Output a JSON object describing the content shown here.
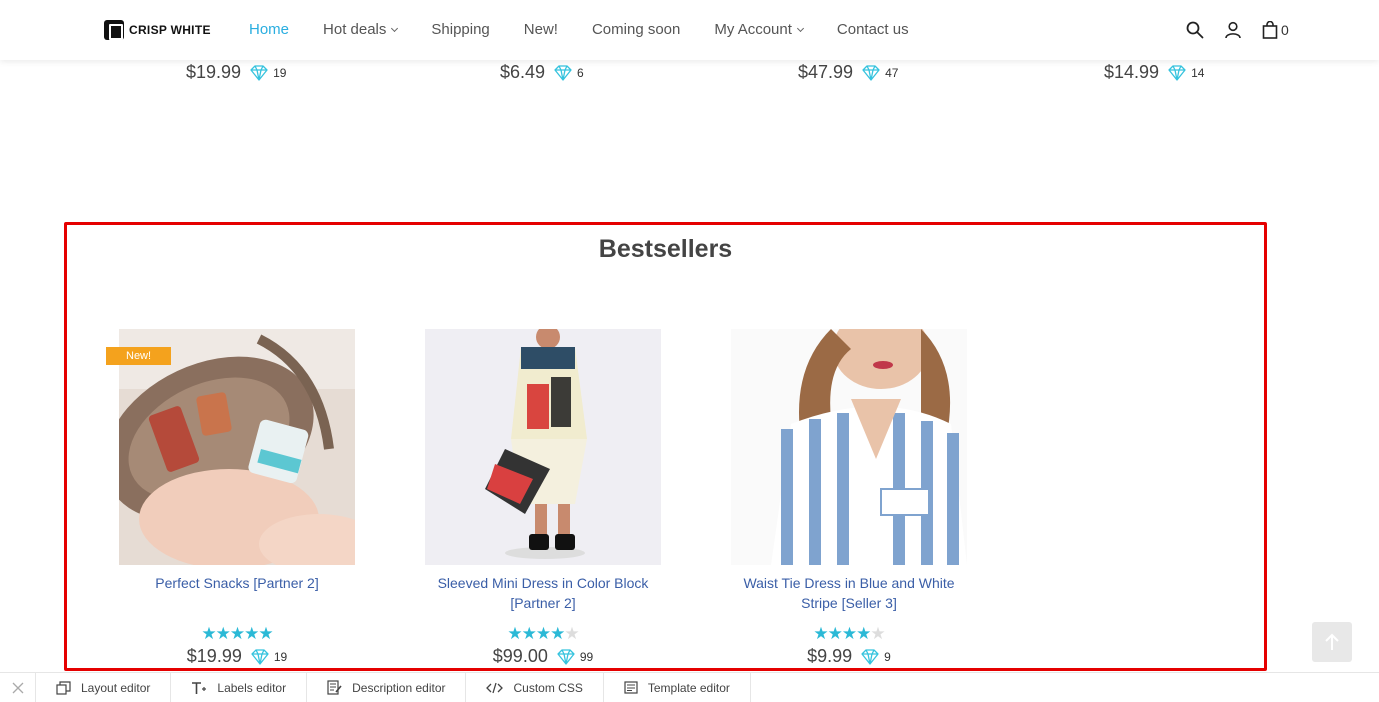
{
  "header": {
    "logo_text": "CRISP WHITE",
    "nav": [
      {
        "label": "Home",
        "active": true,
        "dropdown": false
      },
      {
        "label": "Hot deals",
        "active": false,
        "dropdown": true
      },
      {
        "label": "Shipping",
        "active": false,
        "dropdown": false
      },
      {
        "label": "New!",
        "active": false,
        "dropdown": false
      },
      {
        "label": "Coming soon",
        "active": false,
        "dropdown": false
      },
      {
        "label": "My Account",
        "active": false,
        "dropdown": true
      },
      {
        "label": "Contact us",
        "active": false,
        "dropdown": false
      }
    ],
    "icons": [
      "search-icon",
      "user-icon",
      "cart-icon"
    ],
    "cart_count": "0"
  },
  "top_prices": [
    {
      "price": "$19.99",
      "gems": "19"
    },
    {
      "price": "$6.49",
      "gems": "6"
    },
    {
      "price": "$47.99",
      "gems": "47"
    },
    {
      "price": "$14.99",
      "gems": "14"
    }
  ],
  "bestsellers": {
    "title": "Bestsellers",
    "products": [
      {
        "name": "Perfect Snacks [Partner 2]",
        "rating": 5,
        "price": "$19.99",
        "gems": "19",
        "badge": "New!"
      },
      {
        "name": "Sleeved Mini Dress in Color Block [Partner 2]",
        "rating": 4,
        "price": "$99.00",
        "gems": "99",
        "badge": ""
      },
      {
        "name": "Waist Tie Dress in Blue and White Stripe [Seller 3]",
        "rating": 4,
        "price": "$9.99",
        "gems": "9",
        "badge": ""
      }
    ]
  },
  "toolbar": {
    "items": [
      {
        "label": "Layout editor",
        "icon": "layout-icon"
      },
      {
        "label": "Labels editor",
        "icon": "text-icon"
      },
      {
        "label": "Description editor",
        "icon": "description-icon"
      },
      {
        "label": "Custom CSS",
        "icon": "code-icon"
      },
      {
        "label": "Template editor",
        "icon": "template-icon"
      }
    ]
  },
  "colors": {
    "accent": "#2aaee0",
    "link": "#3a5ea7",
    "star": "#2bb9d6",
    "badge": "#f4a21d",
    "highlight_border": "#e50000"
  }
}
